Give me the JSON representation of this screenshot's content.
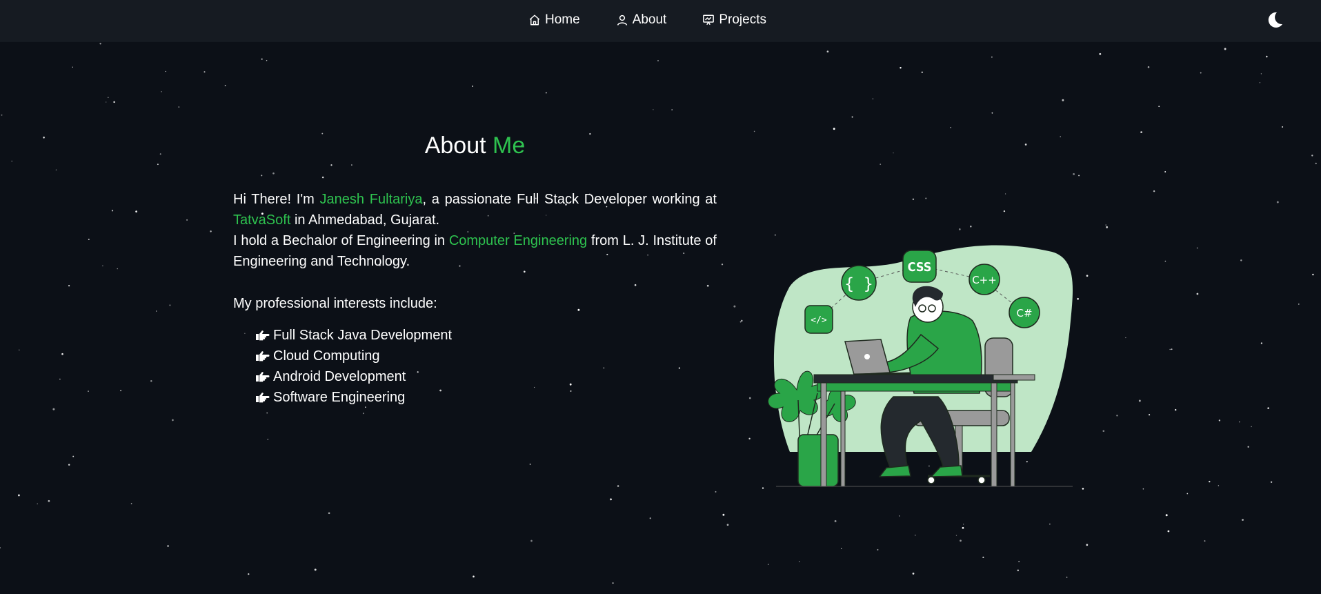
{
  "nav": {
    "home": "Home",
    "about": "About",
    "projects": "Projects",
    "theme_icon": "moon-icon"
  },
  "about": {
    "title_plain": "About ",
    "title_accent": "Me",
    "intro_1": "Hi There! I'm ",
    "name": "Janesh Fultariya",
    "intro_2": ", a passionate Full Stack Developer working at ",
    "company": "TatvaSoft",
    "intro_3": " in Ahmedabad, Gujarat.",
    "edu_1": "I hold a Bechalor of Engineering in ",
    "degree": "Computer Engineering",
    "edu_2": " from L. J. Institute of Engineering and Technology.",
    "interests_intro": "My professional interests include:",
    "interests": [
      "Full Stack Java Development",
      "Cloud Computing",
      "Android Development",
      "Software Engineering"
    ]
  },
  "illustration": {
    "badges": [
      "{ }",
      "CSS",
      "C++",
      "C#",
      "</>"
    ]
  },
  "colors": {
    "accent": "#2ec24f",
    "background": "#0c1017",
    "navbar": "#161b22",
    "blob": "#bfe6c6"
  }
}
